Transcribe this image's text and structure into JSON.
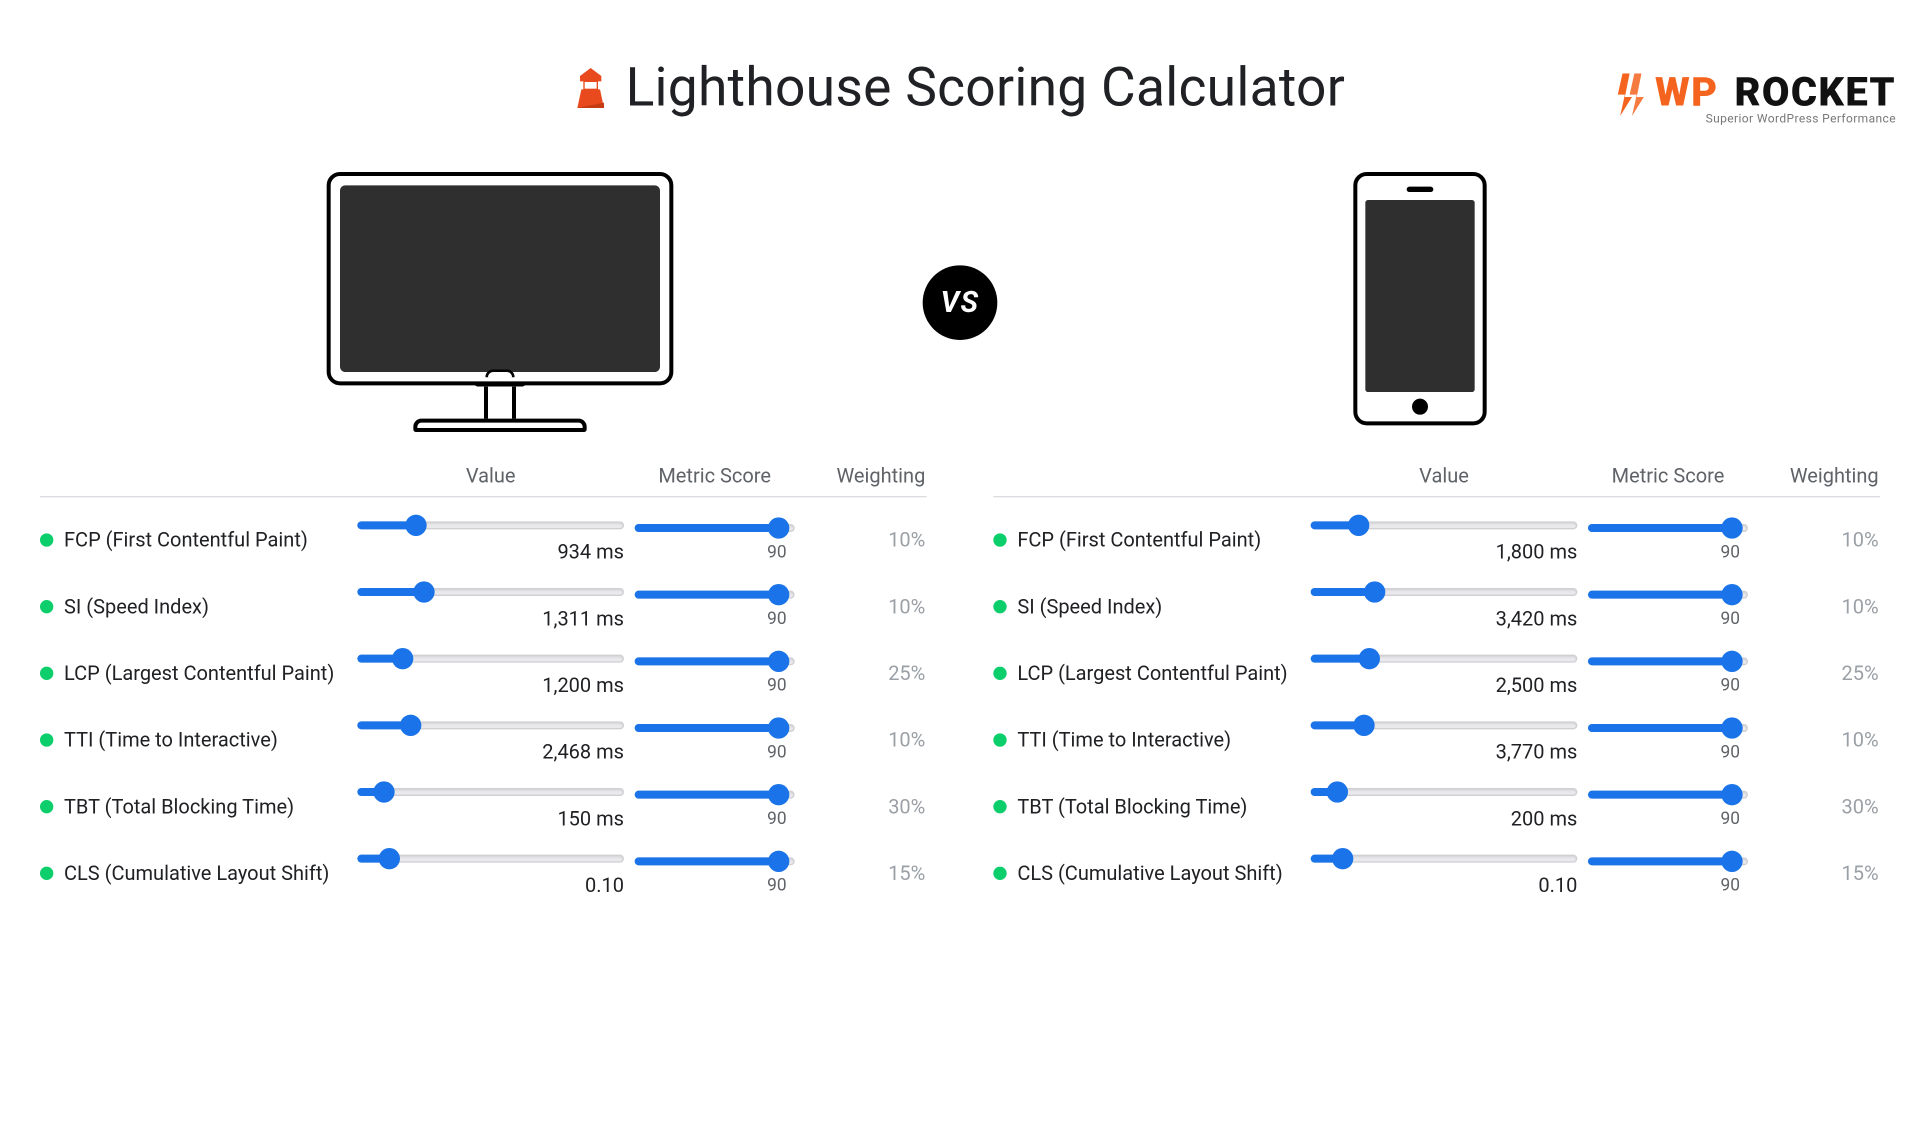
{
  "brand": {
    "wp": "WP",
    "rocket": "ROCKET",
    "tagline": "Superior WordPress Performance"
  },
  "title": "Lighthouse Scoring Calculator",
  "vs": "VS",
  "columns": {
    "value": "Value",
    "score": "Metric Score",
    "weight": "Weighting"
  },
  "desktop": {
    "metrics": [
      {
        "name": "FCP (First Contentful Paint)",
        "valueText": "934 ms",
        "valuePct": 22,
        "score": "90",
        "scorePct": 90,
        "weight": "10%"
      },
      {
        "name": "SI (Speed Index)",
        "valueText": "1,311 ms",
        "valuePct": 25,
        "score": "90",
        "scorePct": 90,
        "weight": "10%"
      },
      {
        "name": "LCP (Largest Contentful Paint)",
        "valueText": "1,200 ms",
        "valuePct": 17,
        "score": "90",
        "scorePct": 90,
        "weight": "25%"
      },
      {
        "name": "TTI (Time to Interactive)",
        "valueText": "2,468 ms",
        "valuePct": 20,
        "score": "90",
        "scorePct": 90,
        "weight": "10%"
      },
      {
        "name": "TBT (Total Blocking Time)",
        "valueText": "150 ms",
        "valuePct": 10,
        "score": "90",
        "scorePct": 90,
        "weight": "30%"
      },
      {
        "name": "CLS (Cumulative Layout Shift)",
        "valueText": "0.10",
        "valuePct": 12,
        "score": "90",
        "scorePct": 90,
        "weight": "15%"
      }
    ]
  },
  "mobile": {
    "metrics": [
      {
        "name": "FCP (First Contentful Paint)",
        "valueText": "1,800 ms",
        "valuePct": 18,
        "score": "90",
        "scorePct": 90,
        "weight": "10%"
      },
      {
        "name": "SI (Speed Index)",
        "valueText": "3,420 ms",
        "valuePct": 24,
        "score": "90",
        "scorePct": 90,
        "weight": "10%"
      },
      {
        "name": "LCP (Largest Contentful Paint)",
        "valueText": "2,500 ms",
        "valuePct": 22,
        "score": "90",
        "scorePct": 90,
        "weight": "25%"
      },
      {
        "name": "TTI (Time to Interactive)",
        "valueText": "3,770 ms",
        "valuePct": 20,
        "score": "90",
        "scorePct": 90,
        "weight": "10%"
      },
      {
        "name": "TBT (Total Blocking Time)",
        "valueText": "200 ms",
        "valuePct": 10,
        "score": "90",
        "scorePct": 90,
        "weight": "30%"
      },
      {
        "name": "CLS (Cumulative Layout Shift)",
        "valueText": "0.10",
        "valuePct": 12,
        "score": "90",
        "scorePct": 90,
        "weight": "15%"
      }
    ]
  }
}
